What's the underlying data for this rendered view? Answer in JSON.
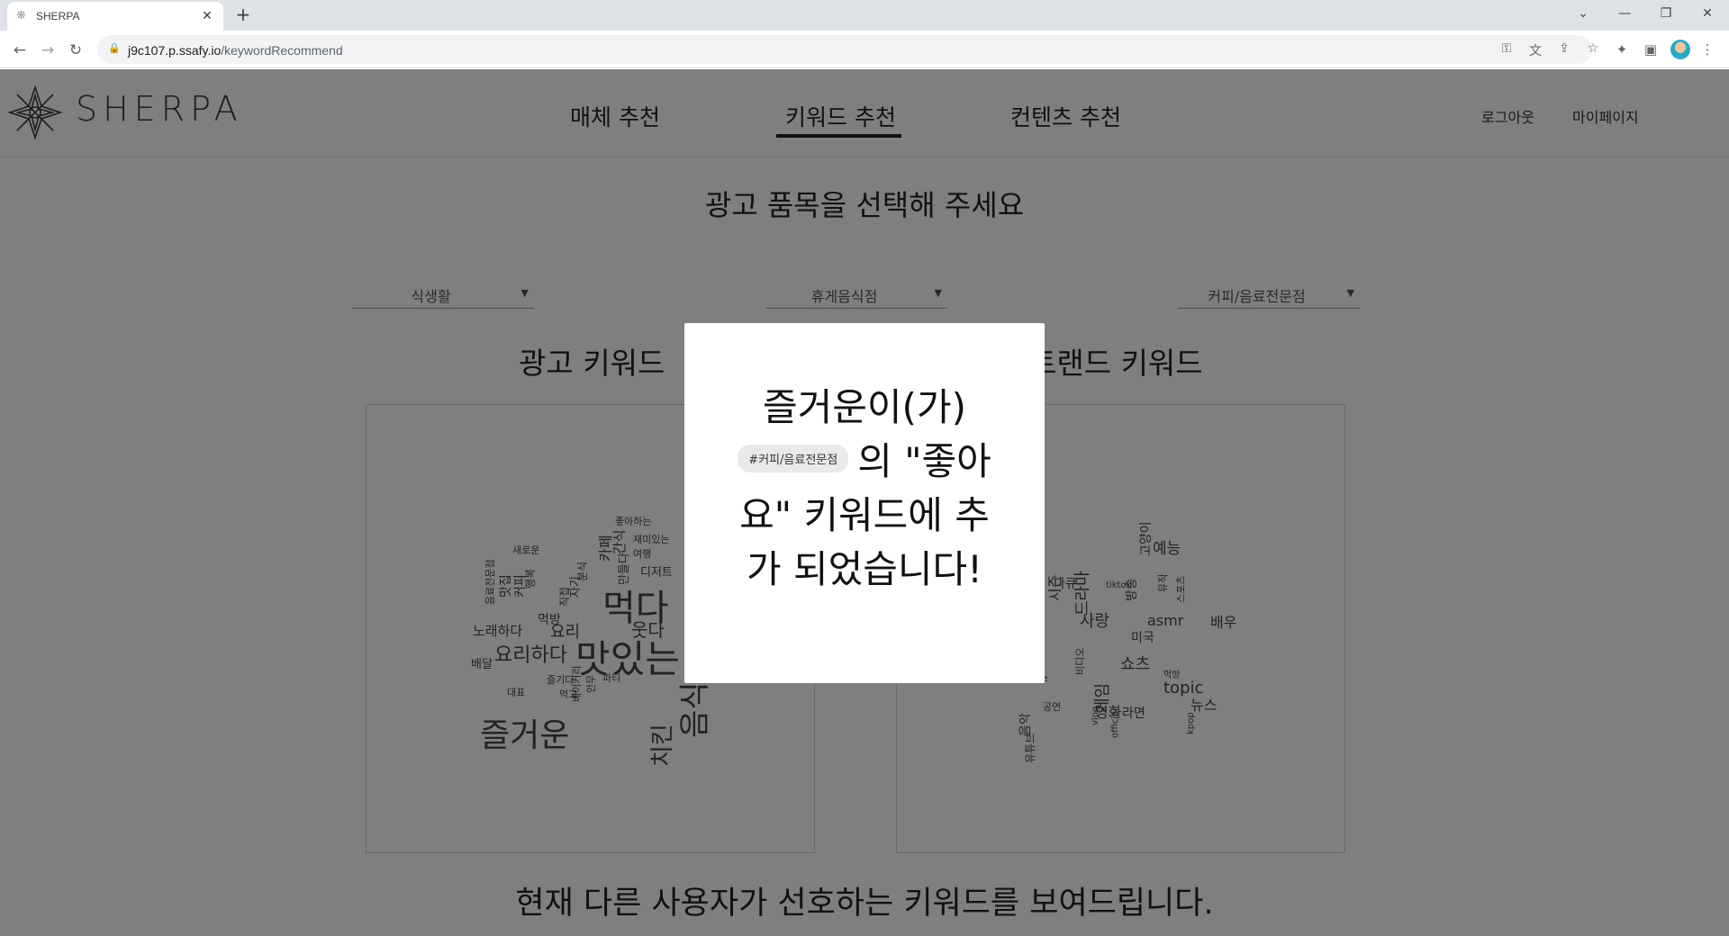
{
  "browser": {
    "tab_title": "SHERPA",
    "url_host": "j9c107.p.ssafy.io",
    "url_path": "/keywordRecommend",
    "icons": [
      "back-icon",
      "forward-icon",
      "reload-icon",
      "lock-icon",
      "key-icon",
      "translate-icon",
      "share-icon",
      "star-icon",
      "extensions-icon",
      "sidepanel-icon",
      "profile-avatar",
      "menu-icon"
    ]
  },
  "header": {
    "logo": "SHERPA",
    "nav": [
      "매체 추천",
      "키워드 추천",
      "컨텐츠 추천"
    ],
    "active_nav": "키워드 추천",
    "logout": "로그아웃",
    "mypage": "마이페이지"
  },
  "main": {
    "prompt": "광고 품목을 선택해 주세요",
    "selects": [
      "식생활",
      "휴게음식점",
      "커피/음료전문점"
    ],
    "ad_keyword_title": "광고 키워드",
    "trend_keyword_title": "트랜드 키워드",
    "footer_text": "현재 다른 사용자가 선호하는 키워드를 보여드립니다."
  },
  "ad_cloud_words": [
    "즐거운",
    "맛있는",
    "먹다",
    "요리하다",
    "치킨",
    "음식",
    "웃다",
    "요리",
    "노래하다",
    "먹방",
    "배달",
    "맛집",
    "커피",
    "음료전문점",
    "좋아하는",
    "재미있는",
    "여행",
    "분식",
    "카페",
    "간식",
    "디저트",
    "만들다",
    "직접",
    "자기",
    "행복",
    "새로운",
    "즐기다",
    "파티",
    "베이커리",
    "안무",
    "먹고",
    "대표"
  ],
  "trend_cloud_words": [
    "사랑",
    "asmr",
    "topic",
    "쇼츠",
    "예능",
    "배우",
    "영화",
    "라면",
    "게임",
    "드라마",
    "다큐",
    "음악",
    "미국",
    "고양이",
    "시즌",
    "방송",
    "뉴스",
    "유튜브",
    "뮤직",
    "비디오",
    "스포츠",
    "공연",
    "tiktok",
    "vlog",
    "official",
    "live",
    "먹방",
    "kpop"
  ],
  "modal": {
    "line1": "즐거운이(가)",
    "chip": "#커피/음료전문점",
    "line2_rest": "의 \"좋아",
    "line3": "요\" 키워드에 추",
    "line4": "가 되었습니다!"
  }
}
